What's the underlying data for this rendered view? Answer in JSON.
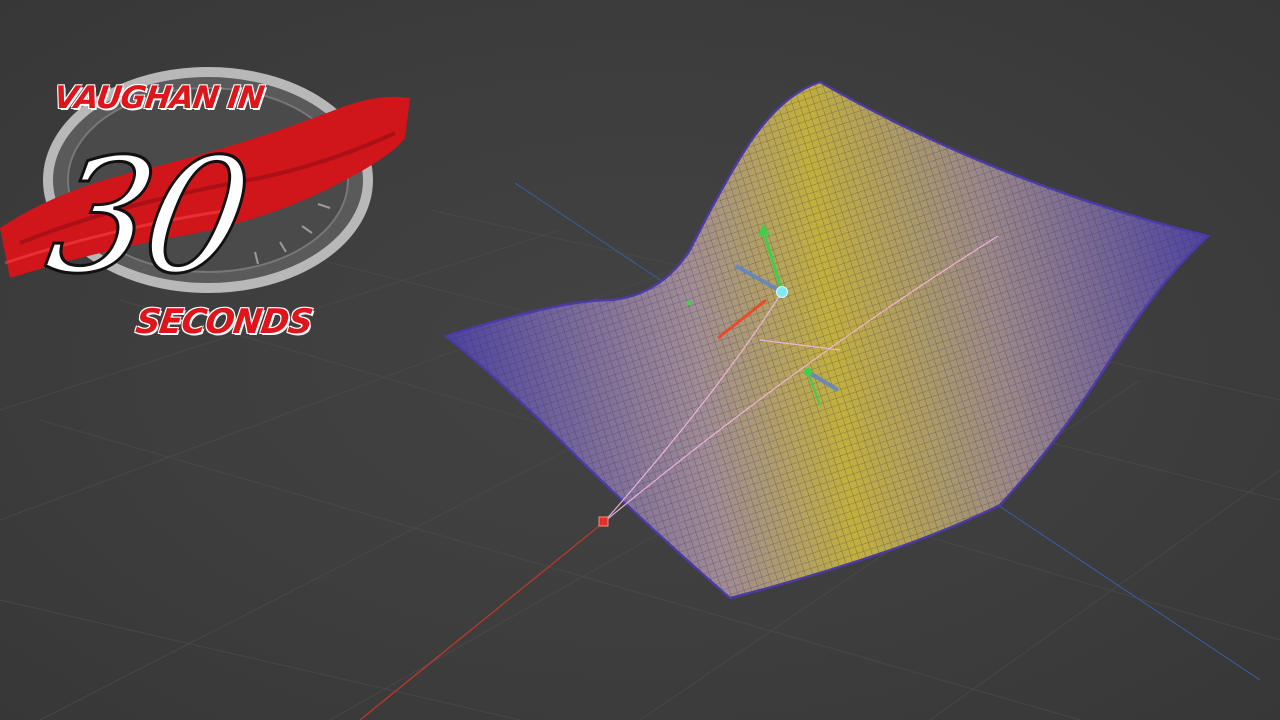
{
  "video_overlay": {
    "title_line": "VAUGHAN IN",
    "number": "30",
    "subtitle": "SECONDS"
  },
  "viewport": {
    "background_color": "#3d3d3d",
    "grid_color": "#4a4a4a",
    "axis_x_color": "#c0392b",
    "axis_z_color": "#3a5ea8",
    "surface_edge_color": "#4b3aa8",
    "surface_center_color": "#e6d32a",
    "spline_color": "#f3b8e0",
    "handle_colors": {
      "x": "#e84a2a",
      "y": "#3fcf4a",
      "z": "#5b86c9",
      "selected_point": "#7fe9f0"
    }
  }
}
